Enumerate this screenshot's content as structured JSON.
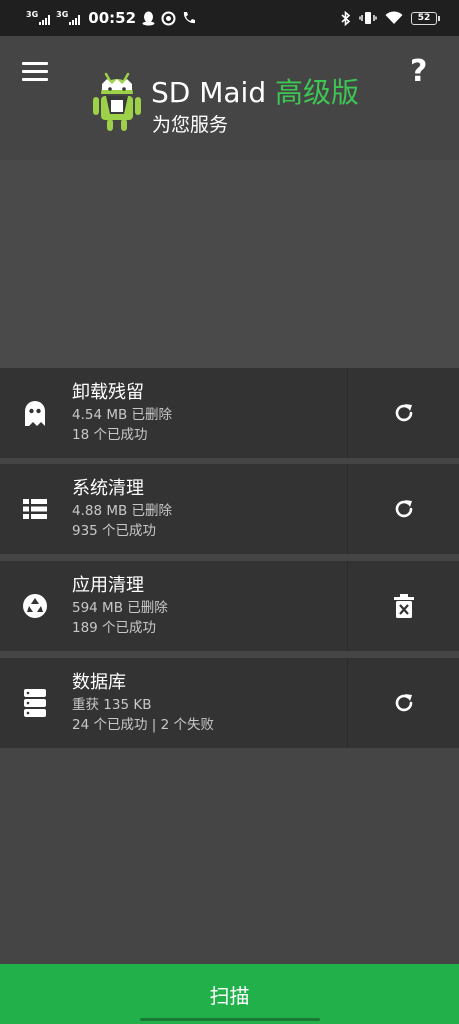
{
  "status_bar": {
    "net1": "3G",
    "net2": "3G",
    "time": "00:52",
    "battery": "52"
  },
  "header": {
    "app_name": "SD Maid",
    "edition": "高级版",
    "subtitle": "为您服务",
    "help": "?"
  },
  "tools": [
    {
      "title": "卸载残留",
      "line1": "4.54 MB 已删除",
      "line2": "18 个已成功",
      "icon": "ghost-icon",
      "action_icon": "refresh-icon"
    },
    {
      "title": "系统清理",
      "line1": "4.88 MB 已删除",
      "line2": "935 个已成功",
      "icon": "list-icon",
      "action_icon": "refresh-icon"
    },
    {
      "title": "应用清理",
      "line1": "594 MB 已删除",
      "line2": "189 个已成功",
      "icon": "recycle-icon",
      "action_icon": "delete-icon"
    },
    {
      "title": "数据库",
      "line1": "重获 135 KB",
      "line2": "24 个已成功 | 2 个失败",
      "icon": "database-icon",
      "action_icon": "refresh-icon"
    }
  ],
  "scan_button": {
    "label": "扫描"
  },
  "colors": {
    "accent": "#21b04a",
    "edition": "#3ec654",
    "background": "#454545",
    "card": "#333333",
    "status_bar": "#1f1f1f"
  }
}
